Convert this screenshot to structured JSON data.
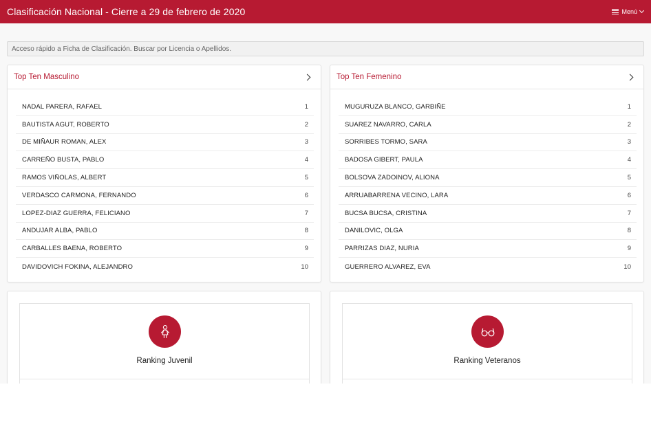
{
  "header": {
    "title": "Clasificación Nacional - Cierre a 29 de febrero de 2020",
    "menu_label": "Menú"
  },
  "search": {
    "placeholder": "Acceso rápido a Ficha de Clasificación. Buscar por Licencia o Apellidos."
  },
  "colors": {
    "accent": "#b71a32"
  },
  "male": {
    "title": "Top Ten Masculino",
    "players": [
      {
        "name": "NADAL PARERA, RAFAEL",
        "rank": "1"
      },
      {
        "name": "BAUTISTA AGUT, ROBERTO",
        "rank": "2"
      },
      {
        "name": "DE MIÑAUR ROMAN, ALEX",
        "rank": "3"
      },
      {
        "name": "CARREÑO BUSTA, PABLO",
        "rank": "4"
      },
      {
        "name": "RAMOS VIÑOLAS, ALBERT",
        "rank": "5"
      },
      {
        "name": "VERDASCO CARMONA, FERNANDO",
        "rank": "6"
      },
      {
        "name": "LOPEZ-DIAZ GUERRA, FELICIANO",
        "rank": "7"
      },
      {
        "name": "ANDUJAR ALBA, PABLO",
        "rank": "8"
      },
      {
        "name": "CARBALLES BAENA, ROBERTO",
        "rank": "9"
      },
      {
        "name": "DAVIDOVICH FOKINA, ALEJANDRO",
        "rank": "10"
      }
    ]
  },
  "female": {
    "title": "Top Ten Femenino",
    "players": [
      {
        "name": "MUGURUZA BLANCO, GARBIÑE",
        "rank": "1"
      },
      {
        "name": "SUAREZ NAVARRO, CARLA",
        "rank": "2"
      },
      {
        "name": "SORRIBES TORMO, SARA",
        "rank": "3"
      },
      {
        "name": "BADOSA GIBERT, PAULA",
        "rank": "4"
      },
      {
        "name": "BOLSOVA ZADOINOV, ALIONA",
        "rank": "5"
      },
      {
        "name": "ARRUABARRENA VECINO, LARA",
        "rank": "6"
      },
      {
        "name": "BUCSA BUCSA, CRISTINA",
        "rank": "7"
      },
      {
        "name": "DANILOVIC, OLGA",
        "rank": "8"
      },
      {
        "name": "PARRIZAS DIAZ, NURIA",
        "rank": "9"
      },
      {
        "name": "GUERRERO ALVAREZ, EVA",
        "rank": "10"
      }
    ]
  },
  "tiles": {
    "junior": {
      "label": "Ranking Juvenil",
      "icon": "child-icon"
    },
    "veterans": {
      "label": "Ranking Veteranos",
      "icon": "glasses-icon"
    }
  }
}
